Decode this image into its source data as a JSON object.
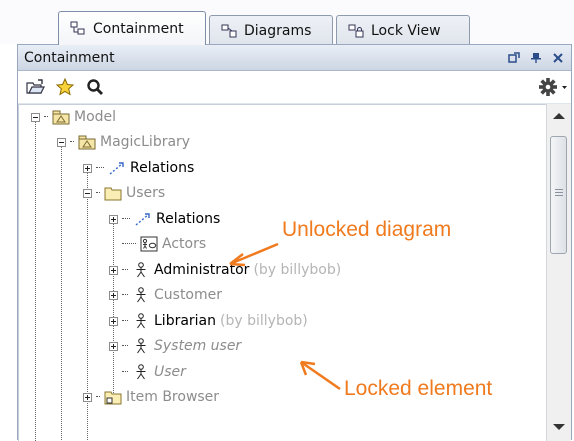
{
  "tabs": [
    {
      "label": "Containment",
      "icon": "containment-tree-icon",
      "active": true
    },
    {
      "label": "Diagrams",
      "icon": "diagrams-icon",
      "active": false
    },
    {
      "label": "Lock View",
      "icon": "lock-view-icon",
      "active": false
    }
  ],
  "panel": {
    "title": "Containment",
    "header_buttons": [
      "undock-icon",
      "pin-icon",
      "close-icon"
    ]
  },
  "toolbar": {
    "buttons": [
      "open-folder-icon",
      "favorite-star-icon",
      "search-icon"
    ],
    "options": "gear-icon"
  },
  "tree": [
    {
      "label": "Model",
      "icon": "package-icon",
      "state": "minus",
      "style": "gray"
    },
    {
      "label": "MagicLibrary",
      "icon": "package-icon",
      "state": "minus",
      "style": "gray"
    },
    {
      "label": "Relations",
      "icon": "relation-icon",
      "state": "plus",
      "style": "black"
    },
    {
      "label": "Users",
      "icon": "folder-icon",
      "state": "minus",
      "style": "gray"
    },
    {
      "label": "Relations",
      "icon": "relation-icon",
      "state": "plus",
      "style": "black"
    },
    {
      "label": "Actors",
      "icon": "diagram-icon",
      "state": "none",
      "style": "gray"
    },
    {
      "label": "Administrator",
      "owner": "(by billybob)",
      "icon": "actor-icon",
      "state": "plus",
      "style": "black"
    },
    {
      "label": "Customer",
      "icon": "actor-icon",
      "state": "plus",
      "style": "gray"
    },
    {
      "label": "Librarian",
      "owner": "(by billybob)",
      "icon": "actor-icon",
      "state": "plus",
      "style": "black"
    },
    {
      "label": "System user",
      "icon": "actor-icon",
      "state": "plus",
      "style": "gray-italic"
    },
    {
      "label": "User",
      "icon": "actor-icon",
      "state": "none",
      "style": "gray-italic"
    },
    {
      "label": "Item Browser",
      "icon": "folder-icon",
      "state": "plus",
      "style": "gray"
    }
  ],
  "annotations": {
    "unlocked": "Unlocked diagram",
    "locked": "Locked element"
  },
  "colors": {
    "annotation": "#f07a1e",
    "header_gradient_top": "#e9eef6",
    "header_gradient_bottom": "#cdd6e4"
  }
}
